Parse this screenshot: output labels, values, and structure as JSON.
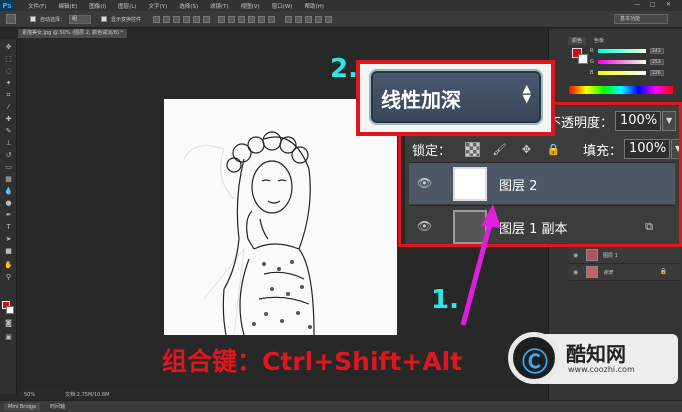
{
  "app": {
    "logo": "Ps"
  },
  "menu": [
    "文件(F)",
    "编辑(E)",
    "图像(I)",
    "图层(L)",
    "文字(Y)",
    "选择(S)",
    "滤镜(T)",
    "视图(V)",
    "窗口(W)",
    "帮助(H)"
  ],
  "options_bar": {
    "auto_select": "自动选择：",
    "auto_select_value": "组",
    "show_transform": "显示变换控件"
  },
  "workspace": "基本功能",
  "document_tab": "素描美女.jpg @ 50% (图层 2, 颜色减淡/8) *",
  "status": {
    "zoom": "50%",
    "doc_size": "文档:2.75M/10.8M"
  },
  "mini_bridge": [
    "Mini Bridge",
    "时间轴"
  ],
  "color_panel": {
    "tabs": [
      "颜色",
      "色板"
    ],
    "sliders": [
      {
        "label": "R",
        "value": "243"
      },
      {
        "label": "G",
        "value": "253"
      },
      {
        "label": "B",
        "value": "226"
      }
    ]
  },
  "mini_layers": [
    {
      "label": "图层 1"
    },
    {
      "label": "背景"
    }
  ],
  "layers_panel": {
    "opacity_label": "不透明度：",
    "opacity_value": "100%",
    "lock_label": "锁定：",
    "fill_label": "填充：",
    "fill_value": "100%",
    "layers": [
      {
        "name": "图层 2",
        "selected": true
      },
      {
        "name": "图层 1 副本",
        "selected": false
      }
    ]
  },
  "blend_mode": {
    "value": "线性加深"
  },
  "annotations": {
    "step1": "1.",
    "step2": "2.",
    "shortcut": "组合键：Ctrl+Shift+Alt",
    "arrow_color": "#e01ee0",
    "highlight_color": "#e0161e"
  },
  "watermark": {
    "title": "酷知网",
    "url": "www.coozhi.com"
  },
  "colors": {
    "foreground": "#e00010",
    "background": "#ffffff"
  }
}
